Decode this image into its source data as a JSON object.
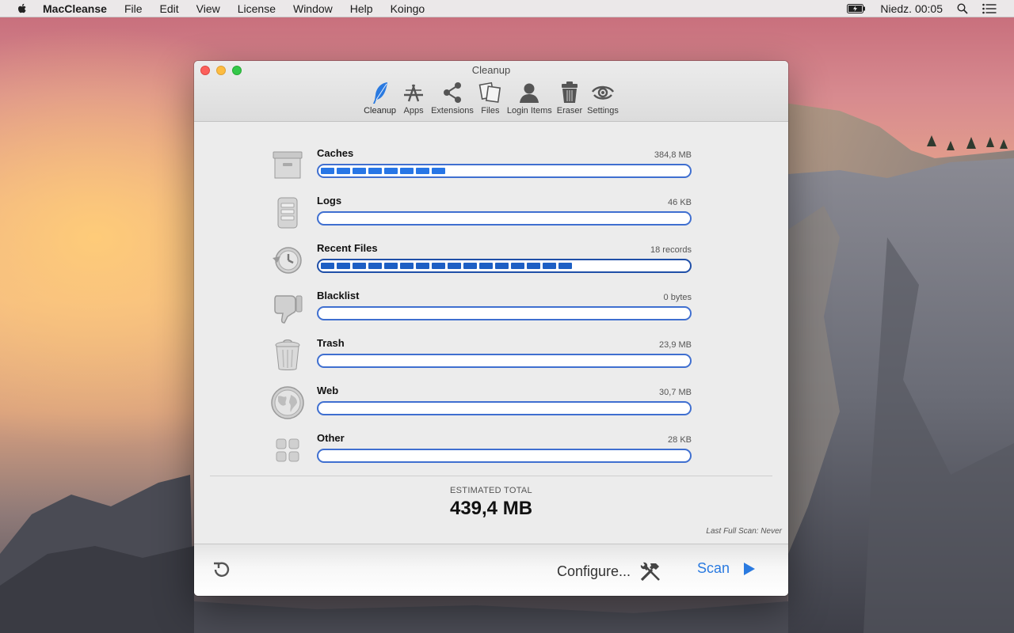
{
  "menubar": {
    "app_name": "MacCleanse",
    "items": [
      "File",
      "Edit",
      "View",
      "License",
      "Window",
      "Help",
      "Koingo"
    ],
    "clock": "Niedz. 00:05",
    "icons": [
      "apple-icon",
      "battery-icon",
      "spotlight-icon",
      "notification-center-icon"
    ]
  },
  "window": {
    "title": "Cleanup",
    "toolbar": [
      {
        "label": "Cleanup",
        "icon": "feather-icon",
        "active": true
      },
      {
        "label": "Apps",
        "icon": "app-store-icon"
      },
      {
        "label": "Extensions",
        "icon": "share-icon"
      },
      {
        "label": "Files",
        "icon": "files-icon"
      },
      {
        "label": "Login Items",
        "icon": "user-icon"
      },
      {
        "label": "Eraser",
        "icon": "shredder-icon"
      },
      {
        "label": "Settings",
        "icon": "eye-settings-icon"
      }
    ],
    "categories": [
      {
        "name": "Caches",
        "size": "384,8 MB",
        "icon": "archive-box-icon",
        "progress": 0.35,
        "segments": 8
      },
      {
        "name": "Logs",
        "size": "46 KB",
        "icon": "log-document-icon",
        "progress": 0,
        "segments": 0
      },
      {
        "name": "Recent Files",
        "size": "18 records",
        "icon": "history-clock-icon",
        "progress": 0.7,
        "segments": 16
      },
      {
        "name": "Blacklist",
        "size": "0 bytes",
        "icon": "thumbs-down-icon",
        "progress": 0,
        "segments": 0
      },
      {
        "name": "Trash",
        "size": "23,9 MB",
        "icon": "trash-icon",
        "progress": 0,
        "segments": 0
      },
      {
        "name": "Web",
        "size": "30,7 MB",
        "icon": "globe-icon",
        "progress": 0,
        "segments": 0
      },
      {
        "name": "Other",
        "size": "28 KB",
        "icon": "grid-icon",
        "progress": 0,
        "segments": 0
      }
    ],
    "estimated_label": "ESTIMATED TOTAL",
    "estimated_total": "439,4 MB",
    "last_scan": "Last Full Scan: Never",
    "bottom": {
      "configure_label": "Configure...",
      "scan_label": "Scan"
    },
    "colors": {
      "accent": "#2a7ae0",
      "bar_border": "#3f6fd0",
      "bar_fill": "#2776e6"
    }
  }
}
